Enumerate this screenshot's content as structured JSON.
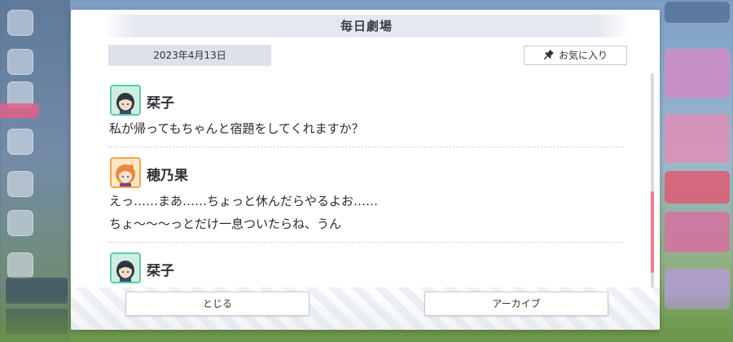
{
  "dialog": {
    "title": "毎日劇場",
    "date": "2023年4月13日",
    "favorite_label": "お気に入り",
    "close_label": "とじる",
    "archive_label": "アーカイブ"
  },
  "entries": [
    {
      "speaker": "栞子",
      "lines": [
        "私が帰ってもちゃんと宿題をしてくれますか？"
      ]
    },
    {
      "speaker": "穂乃果",
      "lines": [
        "えっ……まあ……ちょっと休んだらやるよお……",
        "ちょ～～～っとだけ一息ついたらね、うん"
      ]
    },
    {
      "speaker": "栞子",
      "lines": []
    }
  ],
  "colors": {
    "accent_scroll": "#ef7a92",
    "avatar_border_shioriko": "#5ccba8",
    "avatar_border_honoka": "#f2a44b"
  },
  "icons": [
    "pin-icon",
    "avatar-shioriko",
    "avatar-honoka"
  ]
}
